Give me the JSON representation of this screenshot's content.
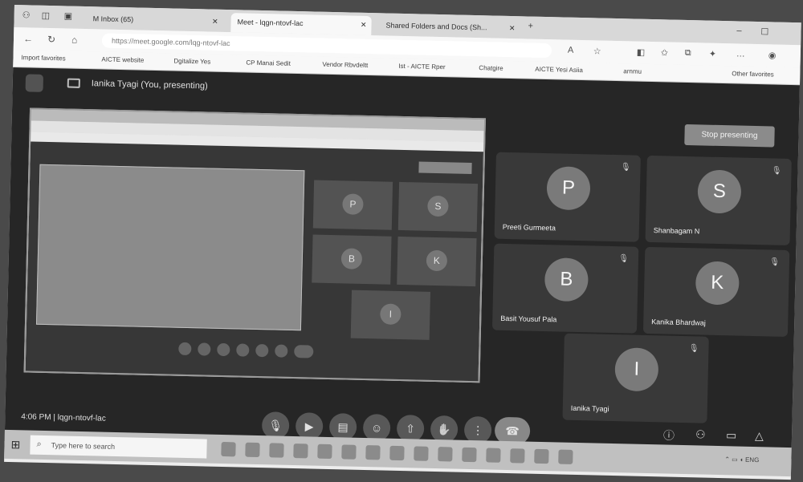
{
  "browser": {
    "tabs": [
      {
        "label": "M Inbox (65)"
      },
      {
        "label": "Meet - lqgn-ntovf-lac"
      },
      {
        "label": "Shared Folders and Docs (Sh..."
      }
    ],
    "url": "https://meet.google.com/lqg-ntovf-lac",
    "bookmarks": [
      "Import favorites",
      "AICTE website",
      "Dgitalize Yes",
      "CP Manai Sedit",
      "Vendor Rbvdeltt",
      "Ist - AICTE Rper",
      "Chatgire",
      "AICTE Yesi Asiia",
      "arnmu",
      "Other favorites"
    ]
  },
  "meet": {
    "presenter_label": "Ianika Tyagi (You, presenting)",
    "stop_label": "Stop presenting",
    "time": "4:06 PM",
    "meeting_code": "lqgn-ntovf-lac",
    "participants": [
      {
        "initial": "P",
        "name": "Preeti Gurmeeta"
      },
      {
        "initial": "S",
        "name": "Shanbagam N"
      },
      {
        "initial": "B",
        "name": "Basit Yousuf Pala"
      },
      {
        "initial": "K",
        "name": "Kanika Bhardwaj"
      },
      {
        "initial": "I",
        "name": "Ianika Tyagi"
      }
    ],
    "shared_initials": [
      "P",
      "S",
      "B",
      "K",
      "I"
    ]
  },
  "taskbar": {
    "search_placeholder": "Type here to search"
  },
  "colors": {
    "bg": "#2a2a2a",
    "tile": "#3c3c3c",
    "avatar": "#7a7a7a"
  }
}
